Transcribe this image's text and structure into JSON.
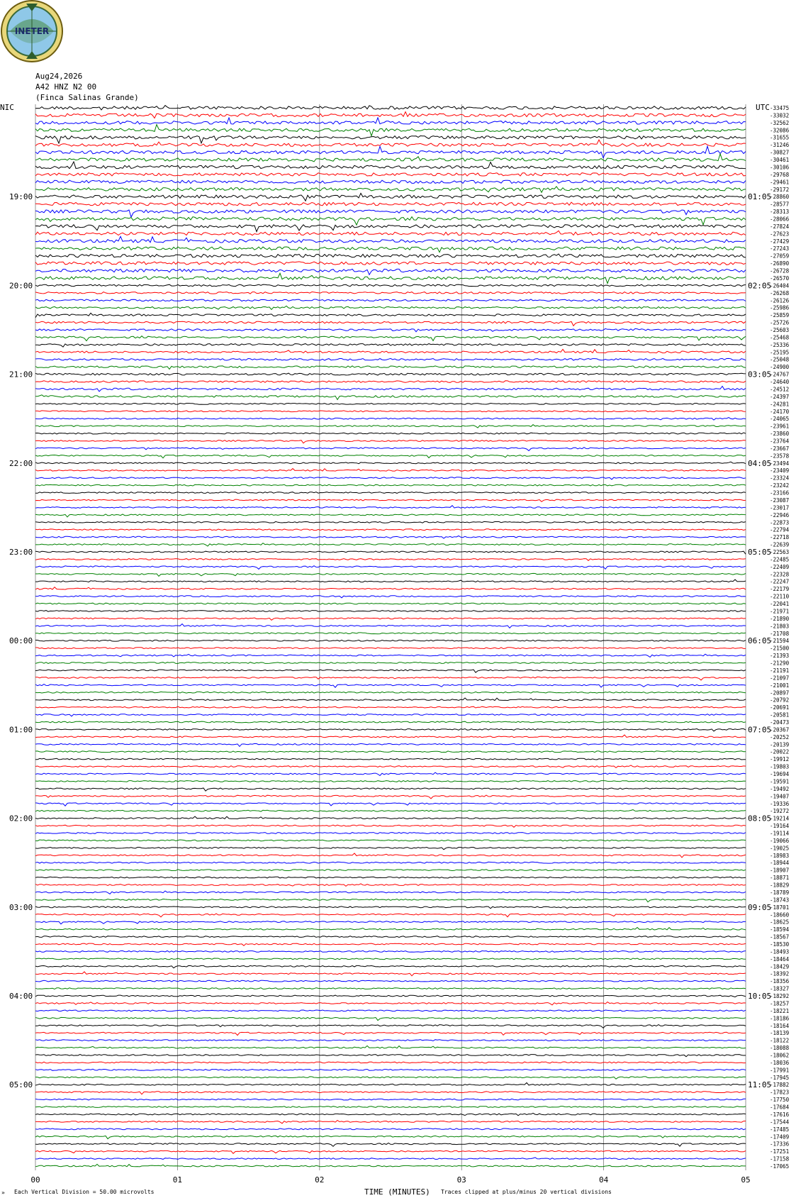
{
  "logo": {
    "label": "INETER",
    "colors": {
      "ring": "#7a6a12",
      "globe": "#3a7a3a",
      "sea": "#8fc8e8",
      "inner": "#f6d86a"
    }
  },
  "header": {
    "date": "Aug24,2026",
    "station": "A42 HNZ N2 00",
    "site": "(Finca Salinas Grande)",
    "left_zone": "NIC",
    "right_zone": "UTC"
  },
  "footer": {
    "scale_note": "Each Vertical Division =   50.00 microvolts",
    "axis_title": "TIME (MINUTES)",
    "clip_note": "Traces clipped at plus/minus 20 vertical divisions",
    "corner_mark": "»"
  },
  "chart_data": {
    "type": "line",
    "title": "",
    "xlabel": "TIME (MINUTES)",
    "x_ticks": [
      "00",
      "01",
      "02",
      "03",
      "04",
      "05"
    ],
    "xlim": [
      0,
      5
    ],
    "trace_colors": [
      "#000000",
      "#ff0000",
      "#0000ff",
      "#008000"
    ],
    "left_time_labels": [
      "19:00",
      "20:00",
      "21:00",
      "22:00",
      "23:00",
      "00:00",
      "01:00",
      "02:00",
      "03:00",
      "04:00",
      "05:00"
    ],
    "right_time_labels": [
      "01:05",
      "02:05",
      "03:05",
      "04:05",
      "05:05",
      "06:05",
      "07:05",
      "08:05",
      "09:05",
      "10:05",
      "11:05"
    ],
    "trace_values": [
      -33475,
      -33032,
      -32562,
      -32086,
      -31655,
      -31246,
      -30827,
      -30461,
      -30106,
      -29768,
      -29461,
      -29172,
      -28860,
      -28577,
      -28313,
      -28066,
      -27824,
      -27623,
      -27429,
      -27243,
      -27059,
      -26890,
      -26728,
      -26570,
      -26404,
      -26268,
      -26126,
      -25986,
      -25859,
      -25726,
      -25603,
      -25468,
      -25336,
      -25195,
      -25048,
      -24900,
      -24767,
      -24640,
      -24512,
      -24397,
      -24281,
      -24170,
      -24065,
      -23961,
      -23860,
      -23764,
      -23667,
      -23578,
      -23494,
      -23409,
      -23324,
      -23242,
      -23166,
      -23087,
      -23017,
      -22946,
      -22873,
      -22794,
      -22718,
      -22639,
      -22563,
      -22485,
      -22409,
      -22328,
      -22247,
      -22179,
      -22110,
      -22041,
      -21971,
      -21890,
      -21803,
      -21708,
      -21594,
      -21500,
      -21393,
      -21290,
      -21191,
      -21097,
      -21001,
      -20897,
      -20792,
      -20691,
      -20581,
      -20473,
      -20367,
      -20252,
      -20139,
      -20022,
      -19912,
      -19803,
      -19694,
      -19591,
      -19492,
      -19407,
      -19336,
      -19272,
      -19214,
      -19164,
      -19114,
      -19066,
      -19025,
      -18983,
      -18944,
      -18907,
      -18871,
      -18829,
      -18789,
      -18743,
      -18701,
      -18660,
      -18625,
      -18594,
      -18567,
      -18530,
      -18493,
      -18464,
      -18429,
      -18392,
      -18356,
      -18327,
      -18292,
      -18257,
      -18221,
      -18186,
      -18164,
      -18139,
      -18122,
      -18088,
      -18062,
      -18036,
      -17991,
      -17945,
      -17882,
      -17823,
      -17750,
      -17684,
      -17616,
      -17544,
      -17485,
      -17409,
      -17336,
      -17251,
      -17158,
      -17065
    ],
    "units": "microvolts",
    "division_value": 50.0
  }
}
